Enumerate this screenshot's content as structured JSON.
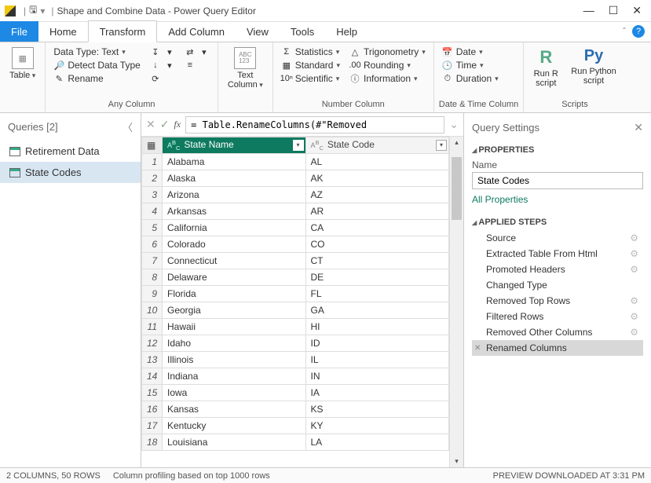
{
  "title": "Shape and Combine Data - Power Query Editor",
  "tabs": [
    "File",
    "Home",
    "Transform",
    "Add Column",
    "View",
    "Tools",
    "Help"
  ],
  "active_tab": "Transform",
  "ribbon": {
    "table_btn": "Table",
    "any_column": {
      "label": "Any Column",
      "datatype": "Data Type: Text",
      "detect": "Detect Data Type",
      "rename": "Rename"
    },
    "text_col": {
      "btn": "Text\nColumn"
    },
    "number_col": {
      "label": "Number Column",
      "stats": "Statistics",
      "standard": "Standard",
      "scientific": "Scientific",
      "trig": "Trigonometry",
      "rounding": "Rounding",
      "info": "Information"
    },
    "datetime": {
      "label": "Date & Time Column",
      "date": "Date",
      "time": "Time",
      "duration": "Duration"
    },
    "scripts": {
      "label": "Scripts",
      "r": "Run R\nscript",
      "py": "Run Python\nscript"
    }
  },
  "queries": {
    "header": "Queries [2]",
    "items": [
      {
        "label": "Retirement Data",
        "selected": false
      },
      {
        "label": "State Codes",
        "selected": true
      }
    ]
  },
  "formula": "= Table.RenameColumns(#\"Removed",
  "columns": [
    {
      "label": "State Name",
      "type": "ABC",
      "active": true
    },
    {
      "label": "State Code",
      "type": "ABC",
      "active": false
    }
  ],
  "rows": [
    [
      "Alabama",
      "AL"
    ],
    [
      "Alaska",
      "AK"
    ],
    [
      "Arizona",
      "AZ"
    ],
    [
      "Arkansas",
      "AR"
    ],
    [
      "California",
      "CA"
    ],
    [
      "Colorado",
      "CO"
    ],
    [
      "Connecticut",
      "CT"
    ],
    [
      "Delaware",
      "DE"
    ],
    [
      "Florida",
      "FL"
    ],
    [
      "Georgia",
      "GA"
    ],
    [
      "Hawaii",
      "HI"
    ],
    [
      "Idaho",
      "ID"
    ],
    [
      "Illinois",
      "IL"
    ],
    [
      "Indiana",
      "IN"
    ],
    [
      "Iowa",
      "IA"
    ],
    [
      "Kansas",
      "KS"
    ],
    [
      "Kentucky",
      "KY"
    ],
    [
      "Louisiana",
      "LA"
    ]
  ],
  "settings": {
    "header": "Query Settings",
    "properties_label": "PROPERTIES",
    "name_label": "Name",
    "name_value": "State Codes",
    "all_props": "All Properties",
    "steps_label": "APPLIED STEPS",
    "steps": [
      {
        "label": "Source",
        "gear": true
      },
      {
        "label": "Extracted Table From Html",
        "gear": true
      },
      {
        "label": "Promoted Headers",
        "gear": true
      },
      {
        "label": "Changed Type",
        "gear": false
      },
      {
        "label": "Removed Top Rows",
        "gear": true
      },
      {
        "label": "Filtered Rows",
        "gear": true
      },
      {
        "label": "Removed Other Columns",
        "gear": true
      },
      {
        "label": "Renamed Columns",
        "gear": false,
        "selected": true
      }
    ]
  },
  "status": {
    "left1": "2 COLUMNS, 50 ROWS",
    "left2": "Column profiling based on top 1000 rows",
    "right": "PREVIEW DOWNLOADED AT 3:31 PM"
  }
}
